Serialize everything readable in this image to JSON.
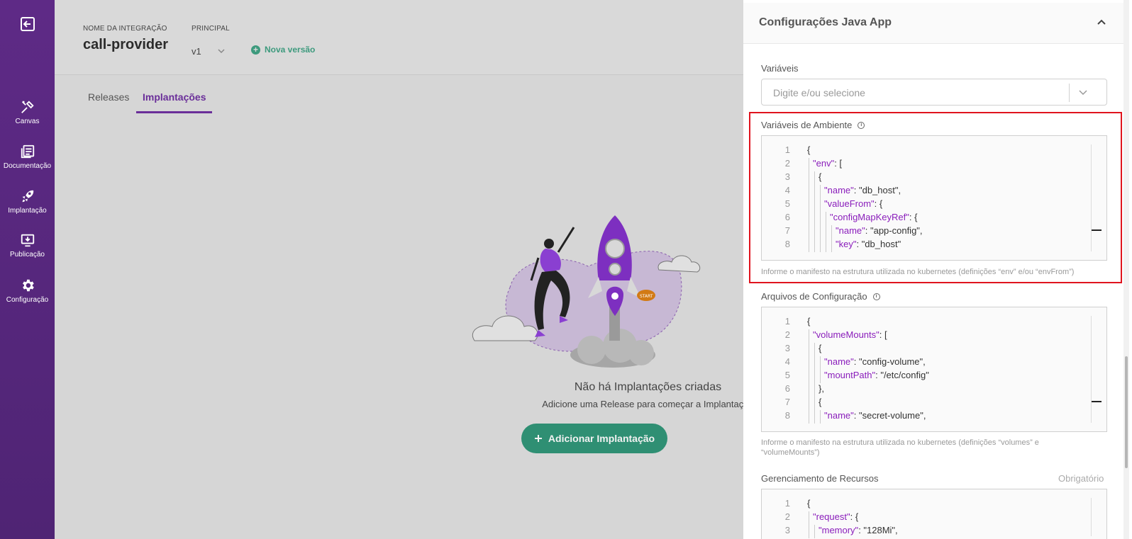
{
  "sidebar": {
    "items": [
      {
        "label": "Canvas",
        "icon": "tools-icon"
      },
      {
        "label": "Documentação",
        "icon": "docs-icon"
      },
      {
        "label": "Implantação",
        "icon": "rocket-icon"
      },
      {
        "label": "Publicação",
        "icon": "publish-icon"
      },
      {
        "label": "Configuração",
        "icon": "gear-icon"
      }
    ]
  },
  "header": {
    "name_label": "NOME DA INTEGRAÇÃO",
    "name": "call-provider",
    "principal_label": "PRINCIPAL",
    "version": "v1",
    "new_version": "Nova versão"
  },
  "tabs": [
    {
      "label": "Releases"
    },
    {
      "label": "Implantações"
    }
  ],
  "empty": {
    "title": "Não há Implantações criadas",
    "subtitle": "Adicione uma Release para começar a Implantação",
    "button": "Adicionar Implantação"
  },
  "illustration": {
    "start_sign": "START"
  },
  "panel": {
    "title": "Configurações Java App",
    "variables_label": "Variáveis",
    "variables_placeholder": "Digite e/ou selecione",
    "env_label": "Variáveis de Ambiente",
    "env_hint": "Informe o manifesto na estrutura utilizada no kubernetes (definições “env” e/ou “envFrom”)",
    "files_label": "Arquivos de Configuração",
    "files_hint_1": "Informe o manifesto na estrutura utilizada no kubernetes (definições “volumes” e",
    "files_hint_2": "“volumeMounts”)",
    "resources_label": "Gerenciamento de Recursos",
    "required": "Obrigatório"
  },
  "env_code": [
    {
      "n": "1",
      "indent": 0,
      "key": "",
      "rest": "{"
    },
    {
      "n": "2",
      "indent": 1,
      "key": "\"env\"",
      "rest": ": ["
    },
    {
      "n": "3",
      "indent": 2,
      "key": "",
      "rest": "{"
    },
    {
      "n": "4",
      "indent": 3,
      "key": "\"name\"",
      "rest": ": \"db_host\","
    },
    {
      "n": "5",
      "indent": 3,
      "key": "\"valueFrom\"",
      "rest": ": {"
    },
    {
      "n": "6",
      "indent": 4,
      "key": "\"configMapKeyRef\"",
      "rest": ": {"
    },
    {
      "n": "7",
      "indent": 5,
      "key": "\"name\"",
      "rest": ": \"app-config\","
    },
    {
      "n": "8",
      "indent": 5,
      "key": "\"key\"",
      "rest": ": \"db_host\""
    }
  ],
  "files_code": [
    {
      "n": "1",
      "indent": 0,
      "key": "",
      "rest": "{"
    },
    {
      "n": "2",
      "indent": 1,
      "key": "\"volumeMounts\"",
      "rest": ": ["
    },
    {
      "n": "3",
      "indent": 2,
      "key": "",
      "rest": "{"
    },
    {
      "n": "4",
      "indent": 3,
      "key": "\"name\"",
      "rest": ": \"config-volume\","
    },
    {
      "n": "5",
      "indent": 3,
      "key": "\"mountPath\"",
      "rest": ": \"/etc/config\""
    },
    {
      "n": "6",
      "indent": 2,
      "key": "",
      "rest": "},"
    },
    {
      "n": "7",
      "indent": 2,
      "key": "",
      "rest": "{"
    },
    {
      "n": "8",
      "indent": 3,
      "key": "\"name\"",
      "rest": ": \"secret-volume\","
    }
  ],
  "resources_code": [
    {
      "n": "1",
      "indent": 0,
      "key": "",
      "rest": "{"
    },
    {
      "n": "2",
      "indent": 1,
      "key": "\"request\"",
      "rest": ": {"
    },
    {
      "n": "3",
      "indent": 2,
      "key": "\"memory\"",
      "rest": ": \"128Mi\","
    }
  ],
  "colors": {
    "sidebar": "#5e2a86",
    "accent": "#6a2e99",
    "primary_button": "#2f8f73",
    "json_key": "#8a1dbb",
    "highlight_border": "#e0141e"
  }
}
